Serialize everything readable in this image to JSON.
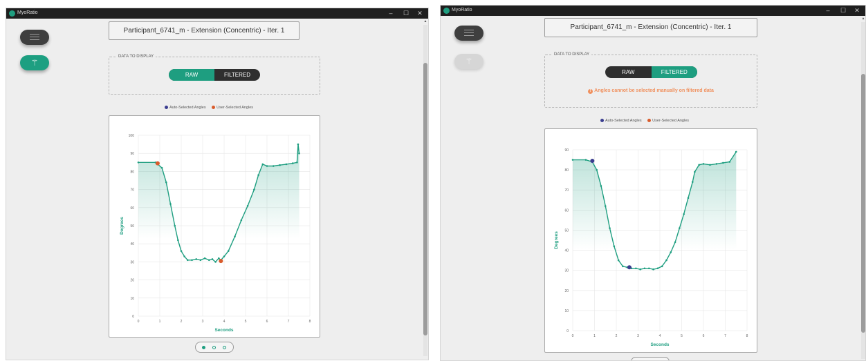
{
  "colors": {
    "accent": "#1e9e80",
    "auto_marker": "#3a3d8f",
    "user_marker": "#d95b2b",
    "warning": "#f0915f",
    "titlebar": "#1f1f1f"
  },
  "windows": [
    {
      "app_title": "MyoRatio",
      "window_controls": [
        "–",
        "☐",
        "✕"
      ],
      "icons": {
        "menu": "hamburger-icon",
        "wand": "magic-wand-icon"
      },
      "wand_enabled": true,
      "title": "Participant_6741_m - Extension (Concentric) - Iter. 1",
      "display_section_label": "DATA TO DISPLAY",
      "toggle": {
        "raw": "RAW",
        "filtered": "FILTERED",
        "selected": "RAW"
      },
      "warning": "",
      "legend": {
        "auto": "Auto-Selected Angles",
        "user": "User-Selected Angles"
      },
      "pager": {
        "pages": 3,
        "current": 1
      },
      "chart_data": {
        "type": "line",
        "xlabel": "Seconds",
        "ylabel": "Degrees",
        "xlim": [
          0,
          8
        ],
        "ylim": [
          0,
          100
        ],
        "x_ticks": [
          0,
          1,
          2,
          3,
          4,
          5,
          6,
          7,
          8
        ],
        "y_ticks": [
          0,
          10,
          20,
          30,
          40,
          50,
          60,
          70,
          80,
          90,
          100
        ],
        "grid": true,
        "fill_under": true,
        "series": [
          {
            "x": [
              0.0,
              0.8,
              0.9,
              1.1,
              1.3,
              1.5,
              1.7,
              1.85,
              2.0,
              2.15,
              2.3,
              2.5,
              2.7,
              2.9,
              3.1,
              3.3,
              3.45,
              3.6,
              3.75,
              3.85,
              4.0,
              4.2,
              4.5,
              4.8,
              5.1,
              5.4,
              5.6,
              5.8,
              6.0,
              6.3,
              6.6,
              6.9,
              7.2,
              7.4,
              7.45,
              7.5
            ],
            "y": [
              85,
              85,
              84,
              82,
              74,
              62,
              50,
              42,
              36,
              33,
              31,
              31,
              31.5,
              31,
              32,
              31,
              31.5,
              30,
              32,
              31,
              33,
              36,
              44,
              53,
              61,
              70,
              78,
              84,
              83,
              83,
              83.5,
              84,
              84.5,
              85,
              95,
              90
            ]
          }
        ],
        "markers": [
          {
            "type": "user",
            "x": 0.9,
            "y": 84.5
          },
          {
            "type": "user",
            "x": 3.85,
            "y": 30.5
          }
        ]
      }
    },
    {
      "app_title": "MyoRatio",
      "window_controls": [
        "–",
        "☐",
        "✕"
      ],
      "icons": {
        "menu": "hamburger-icon",
        "wand": "magic-wand-icon"
      },
      "wand_enabled": false,
      "title": "Participant_6741_m - Extension (Concentric) - Iter. 1",
      "display_section_label": "DATA TO DISPLAY",
      "toggle": {
        "raw": "RAW",
        "filtered": "FILTERED",
        "selected": "FILTERED"
      },
      "warning": "Angles cannot be selected manually on filtered data",
      "legend": {
        "auto": "Auto-Selected Angles",
        "user": "User-Selected Angles"
      },
      "chart_data": {
        "type": "line",
        "xlabel": "Seconds",
        "ylabel": "Degrees",
        "xlim": [
          0,
          8
        ],
        "ylim": [
          0,
          90
        ],
        "x_ticks": [
          0,
          1,
          2,
          3,
          4,
          5,
          6,
          7,
          8
        ],
        "y_ticks": [
          0,
          10,
          20,
          30,
          40,
          50,
          60,
          70,
          80,
          90
        ],
        "grid": true,
        "fill_under": true,
        "series": [
          {
            "x": [
              0.0,
              0.6,
              0.9,
              1.1,
              1.3,
              1.5,
              1.7,
              1.9,
              2.1,
              2.3,
              2.5,
              2.7,
              2.9,
              3.1,
              3.3,
              3.5,
              3.7,
              3.9,
              4.1,
              4.3,
              4.5,
              4.7,
              4.9,
              5.1,
              5.3,
              5.5,
              5.6,
              5.8,
              6.0,
              6.3,
              6.6,
              6.9,
              7.2,
              7.5
            ],
            "y": [
              85,
              85,
              84,
              80,
              72,
              62,
              51,
              42,
              35,
              32,
              31.5,
              31,
              31,
              30.5,
              31,
              31,
              30.5,
              31,
              32,
              35,
              39,
              44,
              51,
              58,
              66,
              74,
              79,
              82.5,
              83,
              82.5,
              83,
              83.5,
              84,
              89
            ]
          }
        ],
        "markers": [
          {
            "type": "auto",
            "x": 0.9,
            "y": 84.5
          },
          {
            "type": "auto",
            "x": 2.6,
            "y": 31.5
          }
        ]
      }
    }
  ]
}
